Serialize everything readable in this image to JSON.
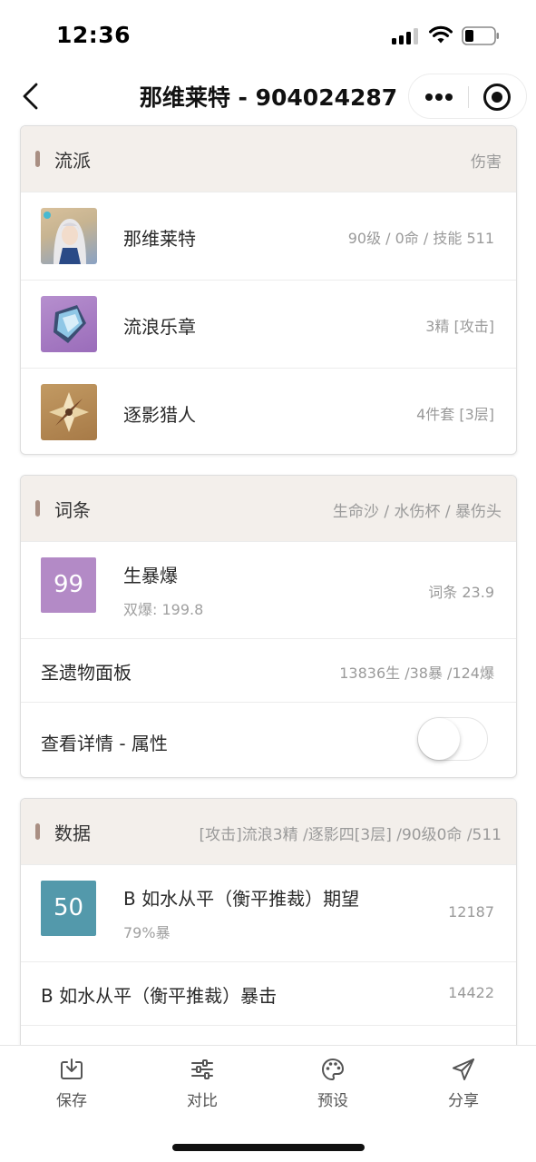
{
  "status_bar": {
    "time": "12:36"
  },
  "nav": {
    "title": "那维莱特 - 904024287"
  },
  "school_card": {
    "title": "流派",
    "right": "伤害",
    "rows": [
      {
        "name": "那维莱特",
        "value": "90级 / 0命 / 技能 511",
        "icon": "character-portrait"
      },
      {
        "name": "流浪乐章",
        "value": "3精 [攻击]",
        "icon": "weapon-catalyst"
      },
      {
        "name": "逐影猎人",
        "value": "4件套 [3层]",
        "icon": "artifact-flower"
      }
    ]
  },
  "substat_card": {
    "title": "词条",
    "right": "生命沙 / 水伤杯 / 暴伤头",
    "score": {
      "value": "99",
      "color": "#b38ac6"
    },
    "score_name": "生暴爆",
    "score_sub": "双爆: 199.8",
    "score_value": "词条 23.9",
    "panel_label": "圣遗物面板",
    "panel_value": "13836生 /38暴 /124爆",
    "detail_label": "查看详情 - 属性",
    "detail_toggle_on": false
  },
  "data_card": {
    "title": "数据",
    "right": "[攻击]流浪3精 /逐影四[3层] /90级0命 /511",
    "score": {
      "value": "50",
      "color": "#5399ab"
    },
    "row1_name": "B 如水从平（衡平推裁）期望",
    "row1_sub": "79%暴",
    "row1_value": "12187",
    "row2_name": "B 如水从平（衡平推裁）暴击",
    "row2_value": "14422"
  },
  "tab_bar": {
    "items": [
      {
        "label": "保存",
        "icon": "download-icon"
      },
      {
        "label": "对比",
        "icon": "sliders-icon"
      },
      {
        "label": "预设",
        "icon": "palette-icon"
      },
      {
        "label": "分享",
        "icon": "send-icon"
      }
    ]
  }
}
